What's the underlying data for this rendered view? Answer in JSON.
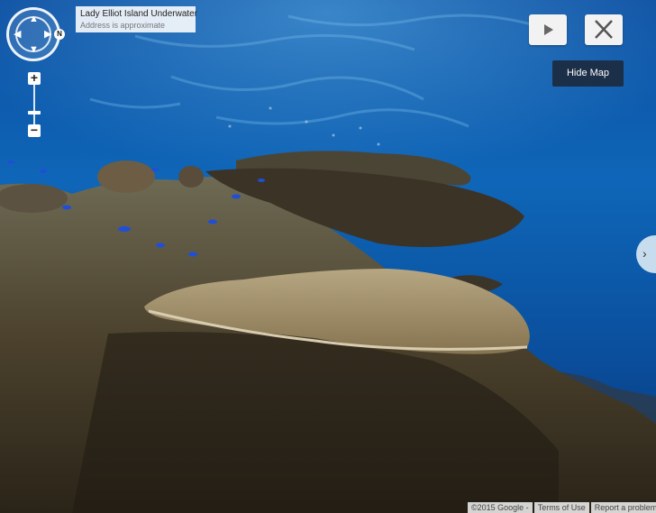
{
  "address": {
    "title": "Lady Elliot Island Underwater",
    "subtitle": "Address is approximate"
  },
  "compass": {
    "letter": "N"
  },
  "zoom": {
    "in_label": "+",
    "out_label": "−"
  },
  "nav": {
    "up": "▲",
    "down": "▼",
    "left": "◀",
    "right": "▶"
  },
  "buttons": {
    "hide_map": "Hide Map",
    "side_tab": "›"
  },
  "footer": {
    "copyright": "©2015 Google -",
    "terms": "Terms of Use",
    "report": "Report a problem"
  },
  "colors": {
    "water_top": "#0c4e9a",
    "water_bottom": "#062a5c",
    "coral": "#7a6a4a",
    "hide_map_bg": "#1c2f48"
  },
  "icons": {
    "play": "play-icon",
    "close": "close-icon",
    "nav": "navigation-arrows-icon"
  }
}
